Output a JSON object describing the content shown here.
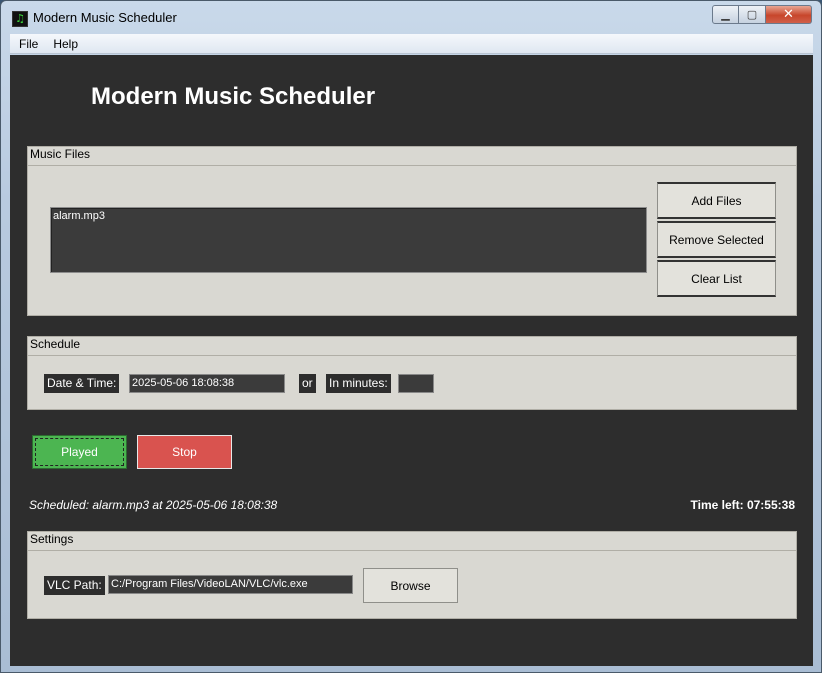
{
  "window": {
    "title": "Modern Music Scheduler",
    "app_icon": "music-note-icon",
    "controls": {
      "minimize": "minimize-icon",
      "maximize": "maximize-icon",
      "close": "close-icon"
    }
  },
  "menu": [
    {
      "label": "File"
    },
    {
      "label": "Help"
    }
  ],
  "header": {
    "title": "Modern Music Scheduler"
  },
  "music_files": {
    "label": "Music Files",
    "items": [
      "alarm.mp3"
    ],
    "add_label": "Add Files",
    "remove_label": "Remove Selected",
    "clear_label": "Clear List"
  },
  "schedule": {
    "label": "Schedule",
    "datetime_label": "Date & Time:",
    "datetime_value": "2025-05-06 18:08:38",
    "or_label": "or",
    "minutes_label": "In minutes:",
    "minutes_value": ""
  },
  "actions": {
    "played_label": "Played",
    "stop_label": "Stop",
    "played_color": "#4cb551",
    "stop_color": "#d9534f"
  },
  "status": {
    "scheduled_text": "Scheduled: alarm.mp3 at 2025-05-06 18:08:38",
    "time_left_text": "Time left: 07:55:38"
  },
  "settings": {
    "label": "Settings",
    "vlc_label": "VLC Path:",
    "vlc_value": "C:/Program Files/VideoLAN/VLC/vlc.exe",
    "browse_label": "Browse"
  },
  "theme": {
    "background": "#2d2d2d",
    "frame": "#d9d8d2"
  }
}
